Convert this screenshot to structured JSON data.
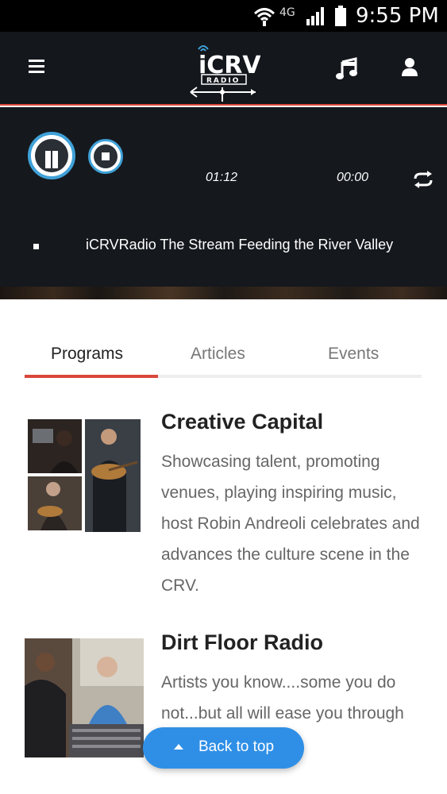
{
  "status_bar": {
    "network": "4G",
    "time": "9:55 PM",
    "icons": [
      "wifi-icon",
      "signal-icon",
      "battery-icon"
    ]
  },
  "header": {
    "logo_text": "iCRV",
    "logo_subtext": "RADIO",
    "icons": [
      "menu-icon",
      "music-note-icon",
      "user-icon"
    ]
  },
  "player": {
    "elapsed": "01:12",
    "duration": "00:00",
    "now_playing": "iCRVRadio The Stream Feeding the River Valley",
    "icons": [
      "pause-icon",
      "stop-icon",
      "repeat-icon"
    ]
  },
  "tabs": [
    {
      "label": "Programs",
      "active": true
    },
    {
      "label": "Articles",
      "active": false
    },
    {
      "label": "Events",
      "active": false
    }
  ],
  "programs": [
    {
      "title": "Creative Capital",
      "description": "Showcasing talent, promoting venues, playing inspiring music, host Robin Andreoli celebrates and advances the culture scene in the CRV."
    },
    {
      "title": "Dirt Floor Radio",
      "description": "Artists you know....some you do not...but all will ease you through"
    }
  ],
  "back_to_top": {
    "label": "Back to top"
  },
  "colors": {
    "accent": "#d9483b",
    "player_bg": "#15181d",
    "button_blue": "#2f8fe6",
    "control_ring": "#3fa1d8"
  }
}
